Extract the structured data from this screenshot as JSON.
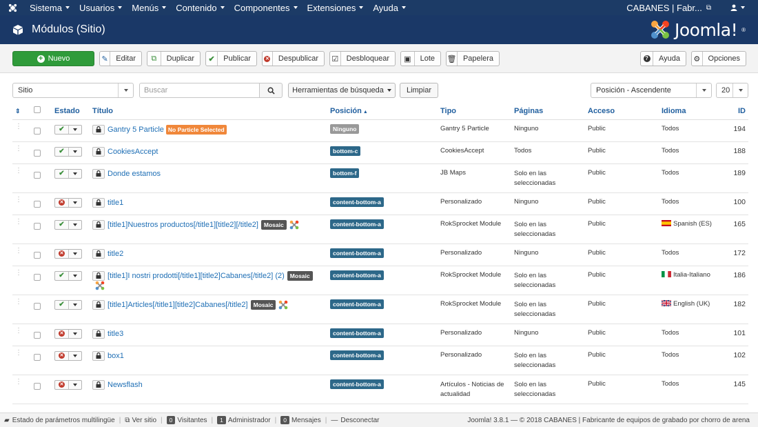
{
  "topnav": {
    "menu": [
      "Sistema",
      "Usuarios",
      "Menús",
      "Contenido",
      "Componentes",
      "Extensiones",
      "Ayuda"
    ],
    "site_name": "CABANES | Fabr..."
  },
  "titlebar": {
    "title": "Módulos (Sitio)",
    "brand": "Joomla!"
  },
  "toolbar": {
    "new_label": "Nuevo",
    "edit_label": "Editar",
    "duplicate_label": "Duplicar",
    "publish_label": "Publicar",
    "unpublish_label": "Despublicar",
    "unlock_label": "Desbloquear",
    "batch_label": "Lote",
    "trash_label": "Papelera",
    "help_label": "Ayuda",
    "options_label": "Opciones"
  },
  "filters": {
    "client": "Sitio",
    "search_placeholder": "Buscar",
    "search_tools_label": "Herramientas de búsqueda",
    "clear_label": "Limpiar",
    "ordering": "Posición - Ascendente",
    "limit": "20"
  },
  "columns": {
    "status": "Estado",
    "title": "Título",
    "position": "Posición",
    "type": "Tipo",
    "pages": "Páginas",
    "access": "Acceso",
    "language": "Idioma",
    "id": "ID"
  },
  "rows": [
    {
      "title": "Gantry 5 Particle",
      "badge": "No Particle Selected",
      "position": "Ninguno",
      "type": "Gantry 5 Particle",
      "pages": "Ninguno",
      "access": "Public",
      "language": "Todos",
      "id": "194"
    },
    {
      "title": "CookiesAccept",
      "position": "bottom-c",
      "type": "CookiesAccept",
      "pages": "Todos",
      "access": "Public",
      "language": "Todos",
      "id": "188"
    },
    {
      "title": "Donde estamos",
      "position": "bottom-f",
      "type": "JB Maps",
      "pages": "Solo en las seleccionadas",
      "access": "Public",
      "language": "Todos",
      "id": "189"
    },
    {
      "title": "title1",
      "position": "content-bottom-a",
      "type": "Personalizado",
      "pages": "Ninguno",
      "access": "Public",
      "language": "Todos",
      "id": "100"
    },
    {
      "title": "[title1]Nuestros productos[/title1][title2][/title2]",
      "tag": "Mosaic",
      "position": "content-bottom-a",
      "type": "RokSprocket Module",
      "pages": "Solo en las seleccionadas",
      "access": "Public",
      "language": "Spanish (ES)",
      "id": "165"
    },
    {
      "title": "title2",
      "position": "content-bottom-a",
      "type": "Personalizado",
      "pages": "Ninguno",
      "access": "Public",
      "language": "Todos",
      "id": "172"
    },
    {
      "title": "[title1]I nostri prodotti[/title1][title2]Cabanes[/title2] (2)",
      "tag": "Mosaic",
      "position": "content-bottom-a",
      "type": "RokSprocket Module",
      "pages": "Solo en las seleccionadas",
      "access": "Public",
      "language": "Italia-Italiano",
      "id": "186"
    },
    {
      "title": "[title1]Articles[/title1][title2]Cabanes[/title2]",
      "tag": "Mosaic",
      "position": "content-bottom-a",
      "type": "RokSprocket Module",
      "pages": "Solo en las seleccionadas",
      "access": "Public",
      "language": "English (UK)",
      "id": "182"
    },
    {
      "title": "title3",
      "position": "content-bottom-a",
      "type": "Personalizado",
      "pages": "Ninguno",
      "access": "Public",
      "language": "Todos",
      "id": "101"
    },
    {
      "title": "box1",
      "position": "content-bottom-a",
      "type": "Personalizado",
      "pages": "Solo en las seleccionadas",
      "access": "Public",
      "language": "Todos",
      "id": "102"
    },
    {
      "title": "Newsflash",
      "position": "content-bottom-a",
      "type": "Artículos - Noticias de actualidad",
      "pages": "Solo en las seleccionadas",
      "access": "Public",
      "language": "Todos",
      "id": "145"
    }
  ],
  "statusbar": {
    "multilang": "Estado de parámetros multilingüe",
    "view_site": "Ver sitio",
    "visitors_count": "0",
    "visitors_label": "Visitantes",
    "admin_count": "1",
    "admin_label": "Administrador",
    "messages_count": "0",
    "messages_label": "Mensajes",
    "logout": "Desconectar",
    "copyright": "Joomla! 3.8.1 — © 2018 CABANES | Fabricante de equipos de grabado por chorro de arena"
  }
}
